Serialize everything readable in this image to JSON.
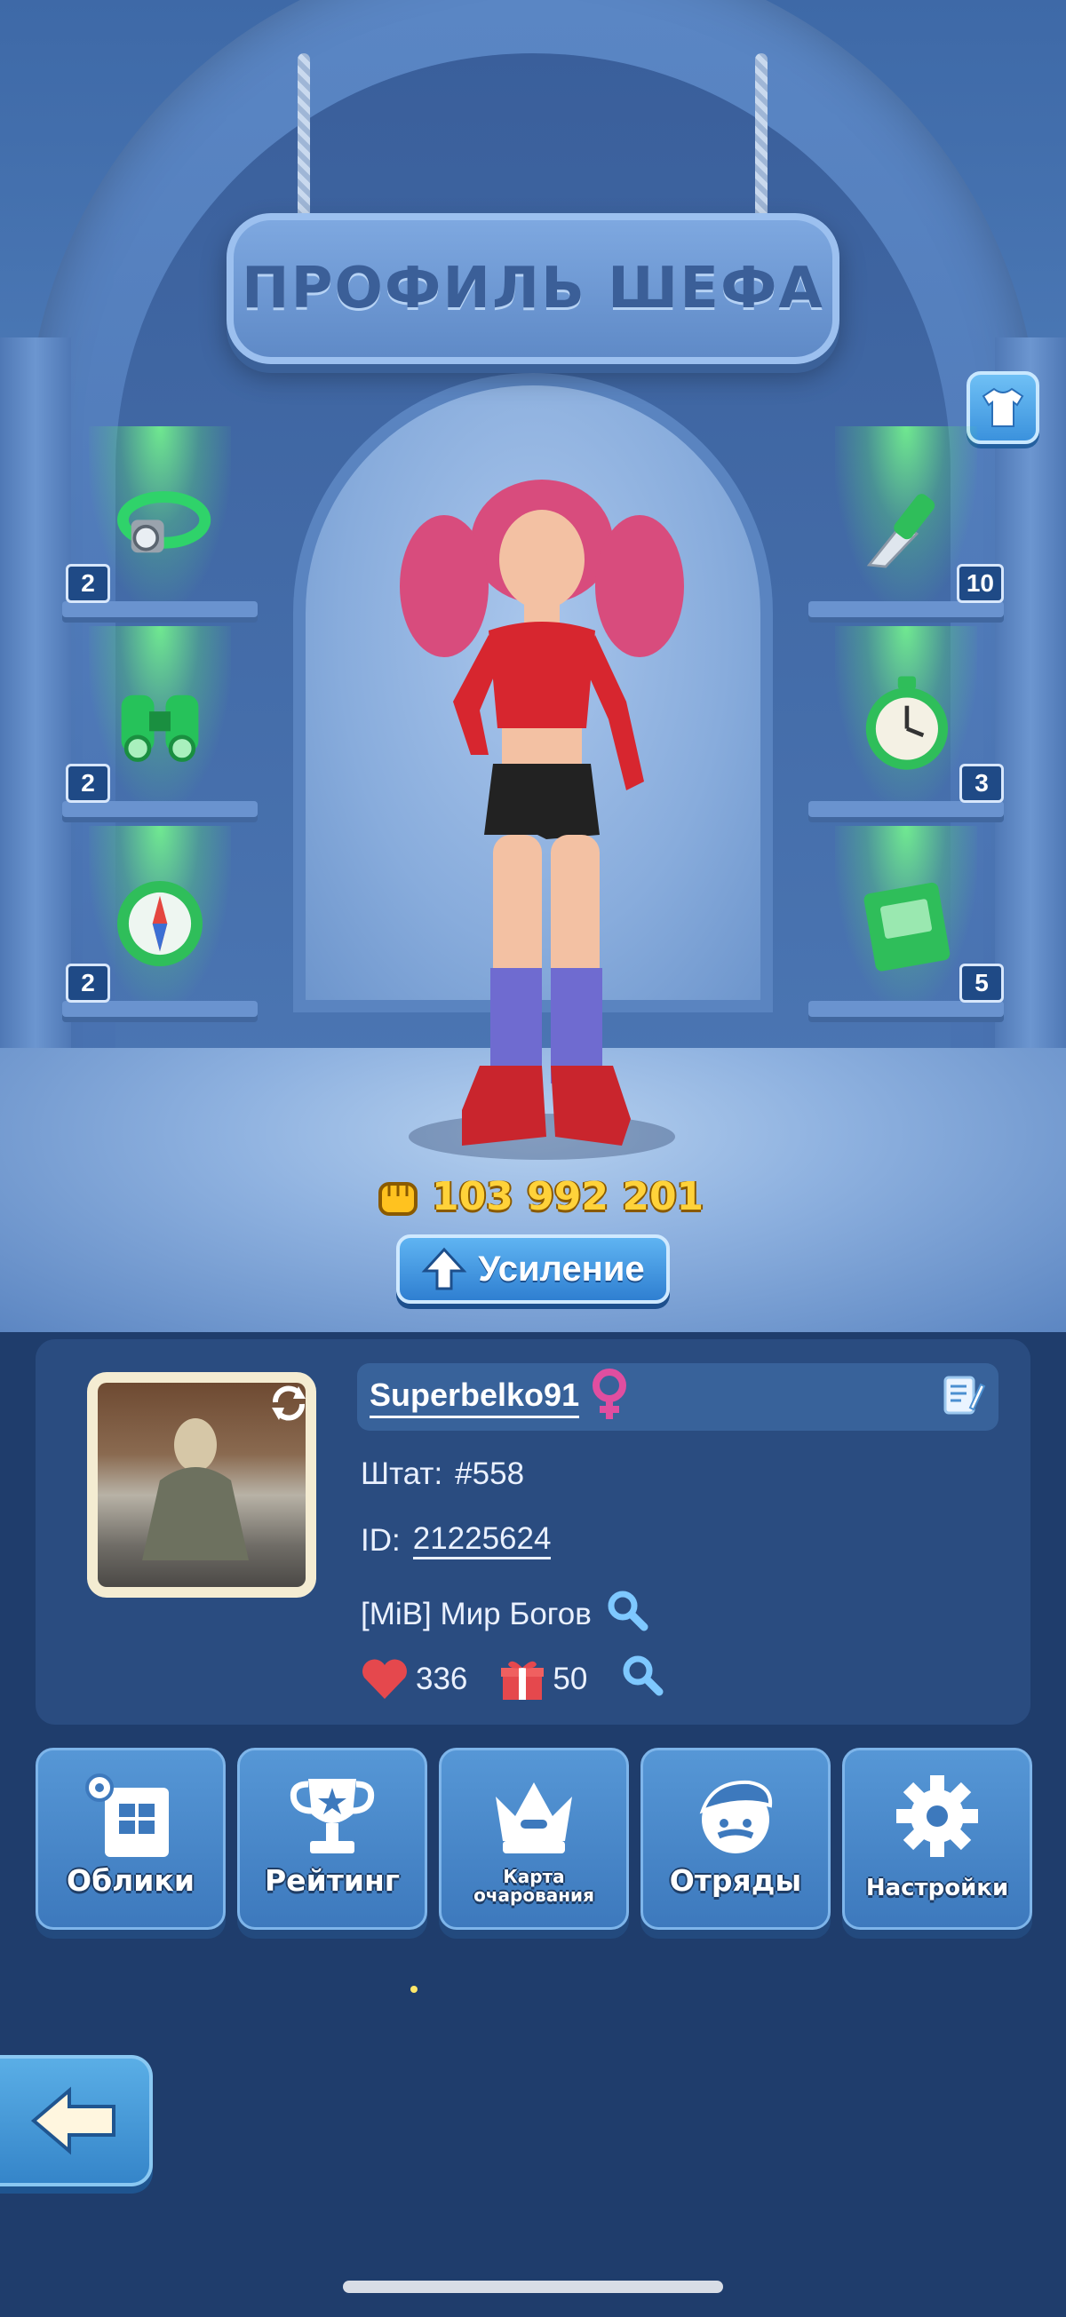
{
  "screen": {
    "title": "ПРОФИЛЬ ШЕФА",
    "power_value": "103 992 201",
    "boost_label": "Усиление"
  },
  "shelves": {
    "left": [
      {
        "icon": "headlamp-icon",
        "count": "2"
      },
      {
        "icon": "binoculars-icon",
        "count": "2"
      },
      {
        "icon": "compass-icon",
        "count": "2"
      }
    ],
    "right": [
      {
        "icon": "knife-icon",
        "count": "10"
      },
      {
        "icon": "stopwatch-icon",
        "count": "3"
      },
      {
        "icon": "book-icon",
        "count": "5"
      }
    ]
  },
  "profile": {
    "username": "Superbelko91",
    "state_label": "Штат:",
    "state_value": "#558",
    "id_label": "ID:",
    "id_value": "21225624",
    "alliance": "[MiB] Мир Богов",
    "likes": "336",
    "gifts": "50"
  },
  "menu": [
    {
      "label": "Облики",
      "icon": "skins-icon"
    },
    {
      "label": "Рейтинг",
      "icon": "trophy-icon"
    },
    {
      "label": "Карта очарования",
      "icon": "crown-icon"
    },
    {
      "label": "Отряды",
      "icon": "squad-icon"
    },
    {
      "label": "Настройки",
      "icon": "gear-icon"
    }
  ],
  "colors": {
    "accent_gold": "#ffd23a",
    "button_blue": "#3d79bd",
    "panel": "#2a4c80",
    "gender_pink": "#e04ea0",
    "like_red": "#e5484d"
  }
}
